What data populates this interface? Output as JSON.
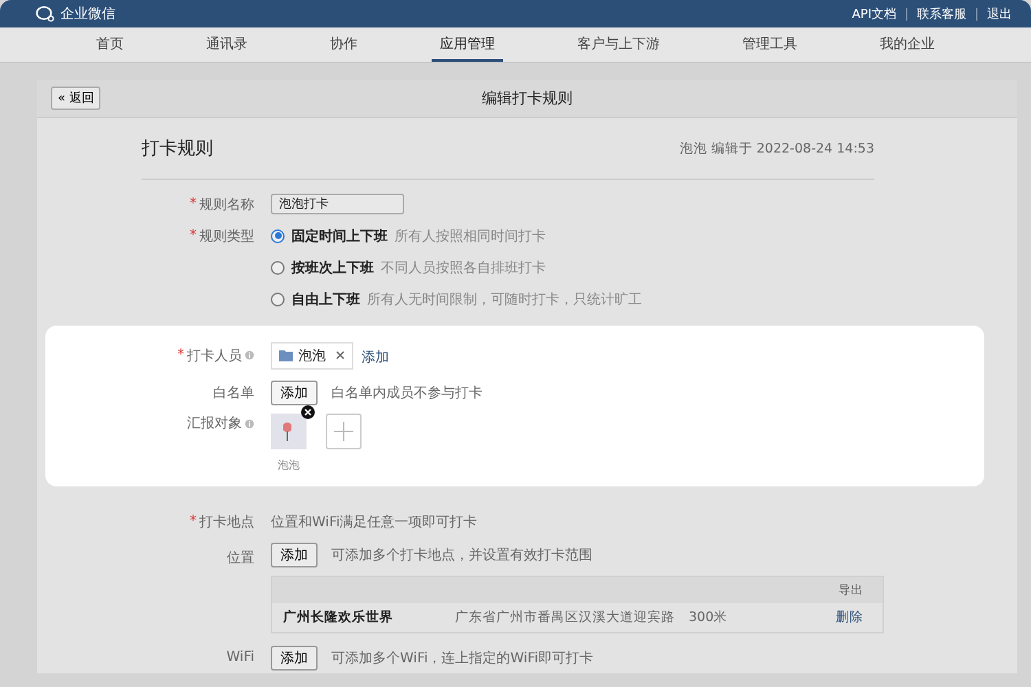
{
  "top_bar": {
    "logo_text": "企业微信",
    "links": [
      "API文档",
      "联系客服",
      "退出"
    ]
  },
  "nav": [
    {
      "label": "首页",
      "selected": false
    },
    {
      "label": "通讯录",
      "selected": false
    },
    {
      "label": "协作",
      "selected": false
    },
    {
      "label": "应用管理",
      "selected": true
    },
    {
      "label": "客户与上下游",
      "selected": false
    },
    {
      "label": "管理工具",
      "selected": false
    },
    {
      "label": "我的企业",
      "selected": false
    }
  ],
  "page": {
    "back_icon": "«",
    "back_button": "返回",
    "title": "编辑打卡规则"
  },
  "rule": {
    "title": "打卡规则",
    "meta": "泡泡 编辑于 2022-08-24 14:53"
  },
  "rule_name": {
    "label": "规则名称",
    "required_mark": "*",
    "value": "泡泡打卡"
  },
  "rule_type": {
    "label": "规则类型",
    "required_mark": "*",
    "options": [
      {
        "label": "固定时间上下班",
        "hint": "所有人按照相同时间打卡",
        "selected": true
      },
      {
        "label": "按班次上下班",
        "hint": "不同人员按照各自排班打卡",
        "selected": false
      },
      {
        "label": "自由上下班",
        "hint": "所有人无时间限制，可随时打卡，只统计旷工",
        "selected": false
      }
    ]
  },
  "members": {
    "label": "打卡人员",
    "required_mark": "*",
    "tags": [
      "泡泡"
    ],
    "add_link": "添加"
  },
  "whitelist": {
    "label": "白名单",
    "button": "添加",
    "hint": "白名单内成员不参与打卡"
  },
  "reporters": {
    "label": "汇报对象",
    "people": [
      "泡泡"
    ]
  },
  "location_section": {
    "label": "打卡地点",
    "required_mark": "*",
    "hint": "位置和WiFi满足任意一项即可打卡"
  },
  "position": {
    "label": "位置",
    "button": "添加",
    "hint": "可添加多个打卡地点，并设置有效打卡范围",
    "export": "导出",
    "rows": [
      {
        "name": "广州长隆欢乐世界",
        "address": "广东省广州市番禺区汉溪大道迎宾路",
        "range": "300米",
        "action": "删除"
      }
    ]
  },
  "wifi": {
    "label": "WiFi",
    "button": "添加",
    "hint": "可添加多个WiFi，连上指定的WiFi即可打卡"
  }
}
